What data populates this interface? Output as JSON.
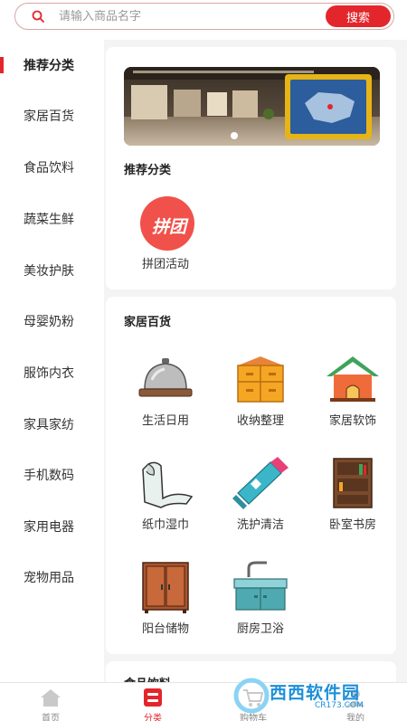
{
  "search": {
    "placeholder": "请输入商品名字",
    "button_label": "搜索"
  },
  "sidebar": {
    "items": [
      {
        "label": "推荐分类",
        "active": true
      },
      {
        "label": "家居百货"
      },
      {
        "label": "食品饮料"
      },
      {
        "label": "蔬菜生鲜"
      },
      {
        "label": "美妆护肤"
      },
      {
        "label": "母婴奶粉"
      },
      {
        "label": "服饰内衣"
      },
      {
        "label": "家具家纺"
      },
      {
        "label": "手机数码"
      },
      {
        "label": "家用电器"
      },
      {
        "label": "宠物用品"
      }
    ]
  },
  "recommend": {
    "title": "推荐分类",
    "items": [
      {
        "label": "拼团活动",
        "icon": "pintuan-icon",
        "icon_text": "拼团"
      }
    ]
  },
  "home": {
    "title": "家居百货",
    "items": [
      {
        "label": "生活日用",
        "icon": "service-bell-icon"
      },
      {
        "label": "收纳整理",
        "icon": "storage-cabinet-icon"
      },
      {
        "label": "家居软饰",
        "icon": "house-icon"
      },
      {
        "label": "纸巾湿巾",
        "icon": "tissue-icon"
      },
      {
        "label": "洗护清洁",
        "icon": "toothpaste-icon"
      },
      {
        "label": "卧室书房",
        "icon": "bookshelf-icon"
      },
      {
        "label": "阳台储物",
        "icon": "wardrobe-icon"
      },
      {
        "label": "厨房卫浴",
        "icon": "kitchen-sink-icon"
      }
    ]
  },
  "food": {
    "title": "食品饮料"
  },
  "bottom_nav": {
    "items": [
      {
        "label": "首页",
        "icon": "home-icon"
      },
      {
        "label": "分类",
        "icon": "category-icon",
        "active": true
      },
      {
        "label": "购物车",
        "icon": "cart-icon"
      },
      {
        "label": "我的",
        "icon": "user-icon"
      }
    ]
  },
  "watermark": {
    "text": "西西软件园",
    "sub": "CR173.COM"
  },
  "colors": {
    "accent": "#e3262c",
    "background": "#f4f4f4"
  }
}
